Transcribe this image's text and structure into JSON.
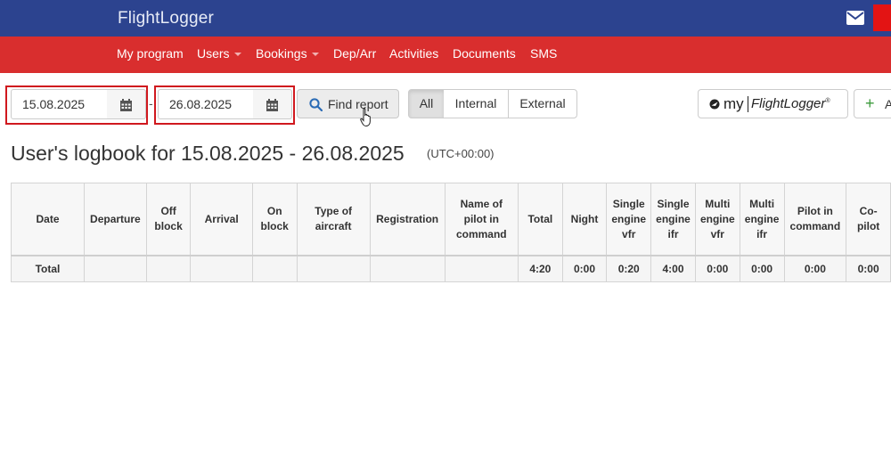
{
  "app": {
    "brand": "FlightLogger"
  },
  "header_icons": [
    "envelope-icon"
  ],
  "nav": {
    "items": [
      {
        "label": "My program",
        "dropdown": false
      },
      {
        "label": "Users",
        "dropdown": true
      },
      {
        "label": "Bookings",
        "dropdown": true
      },
      {
        "label": "Dep/Arr",
        "dropdown": false
      },
      {
        "label": "Activities",
        "dropdown": false
      },
      {
        "label": "Documents",
        "dropdown": false
      },
      {
        "label": "SMS",
        "dropdown": false
      }
    ]
  },
  "filters": {
    "from_date": "15.08.2025",
    "separator": "-",
    "to_date": "26.08.2025",
    "find_label": "Find report",
    "segments": [
      {
        "label": "All",
        "active": true
      },
      {
        "label": "Internal",
        "active": false
      },
      {
        "label": "External",
        "active": false
      }
    ],
    "myfl_prefix": "my",
    "myfl_name": "FlightLogger",
    "myfl_mark": "®",
    "add_label": "A"
  },
  "report": {
    "title": "User's logbook for 15.08.2025 - 26.08.2025",
    "timezone": "(UTC+00:00)"
  },
  "table": {
    "columns": [
      [
        "Date"
      ],
      [
        "Departure"
      ],
      [
        "Off",
        "block"
      ],
      [
        "Arrival"
      ],
      [
        "On",
        "block"
      ],
      [
        "Type of",
        "aircraft"
      ],
      [
        "Registration"
      ],
      [
        "Name of",
        "pilot in",
        "command"
      ],
      [
        "Total"
      ],
      [
        "Night"
      ],
      [
        "Single",
        "engine",
        "vfr"
      ],
      [
        "Single",
        "engine",
        "ifr"
      ],
      [
        "Multi",
        "engine",
        "vfr"
      ],
      [
        "Multi",
        "engine",
        "ifr"
      ],
      [
        "Pilot in",
        "command"
      ],
      [
        "Co-",
        "pilot"
      ]
    ],
    "total_row": [
      "Total",
      "",
      "",
      "",
      "",
      "",
      "",
      "",
      "4:20",
      "0:00",
      "0:20",
      "4:00",
      "0:00",
      "0:00",
      "0:00",
      "0:00"
    ]
  },
  "colors": {
    "topbar": "#2c438f",
    "navbar": "#d92e2e",
    "highlight": "#d0181e"
  }
}
